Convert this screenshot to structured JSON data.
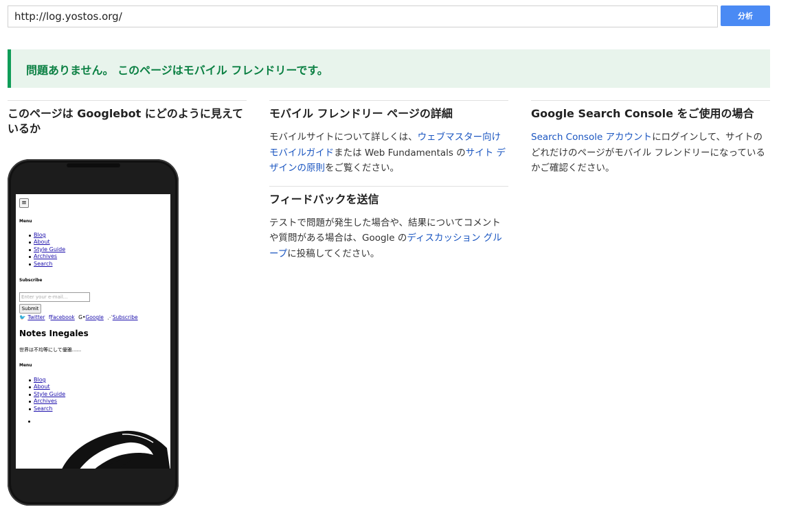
{
  "search": {
    "url": "http://log.yostos.org/",
    "button_label": "分析"
  },
  "result": {
    "message": "問題ありません。 このページはモバイル フレンドリーです。"
  },
  "col1": {
    "heading": "このページは Googlebot にどのように見えているか"
  },
  "col2": {
    "details_heading": "モバイル フレンドリー ページの詳細",
    "details_text1": "モバイルサイトについて詳しくは、",
    "details_link1": "ウェブマスター向けモバイルガイド",
    "details_text2": "または Web Fundamentals の",
    "details_link2": "サイト デザインの原則",
    "details_text3": "をご覧ください。",
    "feedback_heading": "フィードバックを送信",
    "feedback_text1": "テストで問題が発生した場合や、結果についてコメントや質問がある場合は、Google の",
    "feedback_link": "ディスカッション グループ",
    "feedback_text2": "に投稿してください。"
  },
  "col3": {
    "heading": "Google Search Console をご使用の場合",
    "link": "Search Console アカウント",
    "text": "にログインして、サイトのどれだけのページがモバイル フレンドリーになっているかご確認ください。"
  },
  "preview": {
    "hamburger": "≡",
    "menu_label": "Menu",
    "menu_items": [
      "Blog",
      "About",
      "Style Guide",
      "Archives",
      "Search"
    ],
    "subscribe_label": "Subscribe",
    "email_placeholder": "Enter your e-mail...",
    "submit_label": "Submit",
    "social": [
      "Twitter",
      "Facebook",
      "Google",
      "Subscribe"
    ],
    "site_title": "Notes Inegales",
    "site_desc": "世界は不均等にして優雅......",
    "menu_label2": "Menu",
    "menu_items2": [
      "Blog",
      "About",
      "Style Guide",
      "Archives",
      "Search"
    ]
  }
}
